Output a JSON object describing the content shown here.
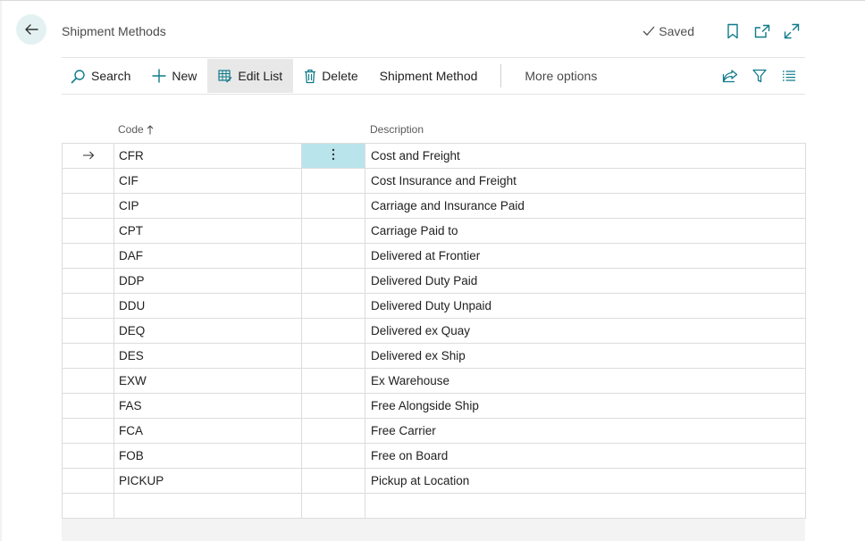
{
  "page": {
    "title": "Shipment Methods",
    "status": "Saved"
  },
  "actions": {
    "search": "Search",
    "new": "New",
    "edit_list": "Edit List",
    "delete": "Delete",
    "shipment_method": "Shipment Method",
    "more_options": "More options"
  },
  "columns": {
    "code": "Code",
    "description": "Description"
  },
  "rows": [
    {
      "code": "CFR",
      "description": "Cost and Freight",
      "selected": true
    },
    {
      "code": "CIF",
      "description": "Cost Insurance and Freight"
    },
    {
      "code": "CIP",
      "description": "Carriage and Insurance Paid"
    },
    {
      "code": "CPT",
      "description": "Carriage Paid to"
    },
    {
      "code": "DAF",
      "description": "Delivered at Frontier"
    },
    {
      "code": "DDP",
      "description": "Delivered Duty Paid"
    },
    {
      "code": "DDU",
      "description": "Delivered Duty Unpaid"
    },
    {
      "code": "DEQ",
      "description": "Delivered ex Quay"
    },
    {
      "code": "DES",
      "description": "Delivered ex Ship"
    },
    {
      "code": "EXW",
      "description": "Ex Warehouse"
    },
    {
      "code": "FAS",
      "description": "Free Alongside Ship"
    },
    {
      "code": "FCA",
      "description": "Free Carrier"
    },
    {
      "code": "FOB",
      "description": "Free on Board"
    },
    {
      "code": "PICKUP",
      "description": "Pickup at Location"
    },
    {
      "code": "",
      "description": ""
    }
  ],
  "icons": {
    "back": "back-arrow-icon",
    "saved": "checkmark-icon",
    "bookmark": "bookmark-icon",
    "open_new": "open-new-window-icon",
    "expand": "expand-icon",
    "search": "search-icon",
    "new": "plus-icon",
    "edit_list": "edit-list-icon",
    "delete": "trash-icon",
    "share": "share-icon",
    "filter": "filter-icon",
    "list_view": "list-view-icon",
    "sort": "sort-ascending-icon",
    "row_indicator": "row-arrow-icon",
    "row_menu": "more-vertical-icon"
  },
  "colors": {
    "accent": "#0f7b8a",
    "selected_cell": "#b9e4ec",
    "back_circle": "#e4f1f3"
  }
}
